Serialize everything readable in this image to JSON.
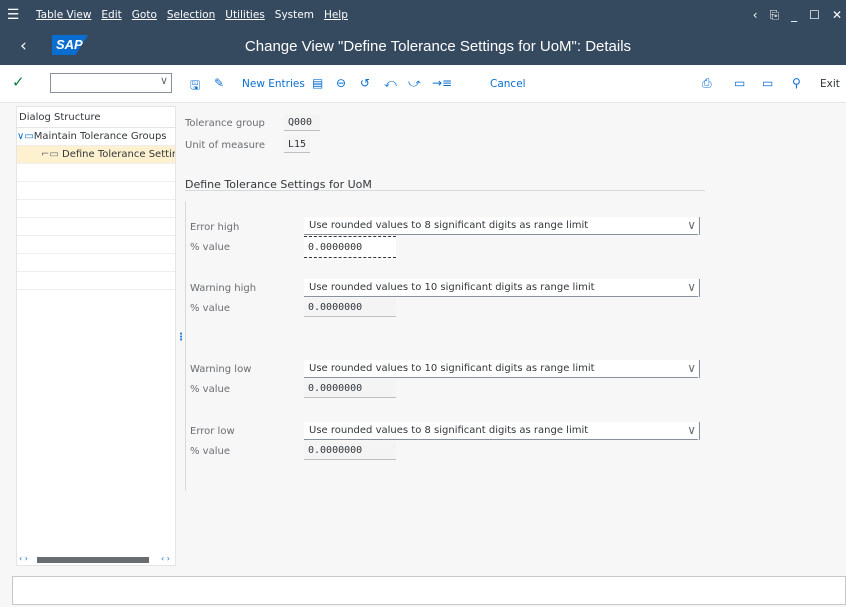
{
  "menu": {
    "items": [
      "Table View",
      "Edit",
      "Goto",
      "Selection",
      "Utilities",
      "System",
      "Help"
    ]
  },
  "titlebar": {
    "logo_text": "SAP",
    "title": "Change View \"Define Tolerance Settings for UoM\": Details"
  },
  "toolbar": {
    "new_entries": "New Entries",
    "cancel": "Cancel",
    "exit": "Exit"
  },
  "dialog": {
    "header": "Dialog Structure",
    "items": [
      "Maintain Tolerance Groups",
      "Define Tolerance Settings"
    ]
  },
  "keys": {
    "tolerance_group_label": "Tolerance group",
    "tolerance_group_value": "Q000",
    "uom_label": "Unit of measure",
    "uom_value": "L15"
  },
  "section": {
    "title": "Define Tolerance Settings for UoM"
  },
  "fields": [
    {
      "label": "Error high",
      "option": "Use rounded values to 8 significant digits as range limit",
      "pct_label": "% value",
      "pct_value": "0.0000000"
    },
    {
      "label": "Warning high",
      "option": "Use rounded values to 10 significant digits as range limit",
      "pct_label": "% value",
      "pct_value": "0.0000000"
    },
    {
      "label": "Warning low",
      "option": "Use rounded values to 10 significant digits as range limit",
      "pct_label": "% value",
      "pct_value": "0.0000000"
    },
    {
      "label": "Error low",
      "option": "Use rounded values to 8 significant digits as range limit",
      "pct_label": "% value",
      "pct_value": "0.0000000"
    }
  ],
  "colors": {
    "shell": "#354a5f",
    "accent": "#0a6ed1",
    "selected_row": "#fdf1cf"
  }
}
